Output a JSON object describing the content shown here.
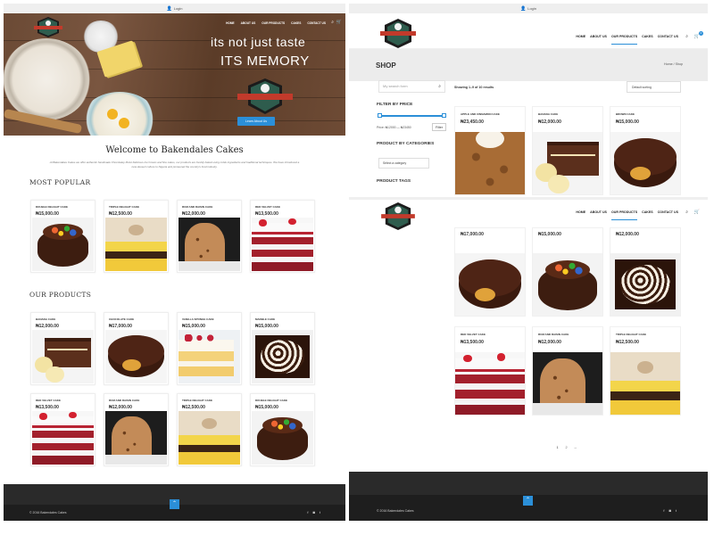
{
  "topbar": {
    "login_label": "Login"
  },
  "nav": {
    "items": [
      "HOME",
      "ABOUT US",
      "OUR PRODUCTS",
      "CAKES",
      "CONTACT US"
    ],
    "active": "OUR PRODUCTS",
    "cart_count": "0"
  },
  "hero": {
    "tagline_1": "its not just taste",
    "tagline_2": "ITS MEMORY",
    "button_label": "Learn About Us"
  },
  "welcome": {
    "title": "Welcome to Bakendales Cakes",
    "text": "At Bakendales Cakes we offer authentic handmade Chocolatey Moist Delicious Ice Cream and fine cakes, our products are freshly baked using noble ingredients and traditional techniques. We have introduced a new dessert culture to Nigeria and pioneered the country's food industry."
  },
  "most_popular": {
    "heading": "MOST POPULAR",
    "products": [
      {
        "name": "DOUBLE DELIGHT CAKE",
        "price": "₦15,000.00",
        "img": "smarties"
      },
      {
        "name": "TRIPLE DELIGHT CAKE",
        "price": "₦12,500.00",
        "img": "triple"
      },
      {
        "name": "RUM AND RAISIN CAKE",
        "price": "₦12,000.00",
        "img": "rum"
      },
      {
        "name": "RED VELVET CAKE",
        "price": "₦13,500.00",
        "img": "velvet"
      }
    ]
  },
  "our_products": {
    "heading": "OUR PRODUCTS",
    "products": [
      {
        "name": "BANANA CAKE",
        "price": "₦12,000.00",
        "img": "banana"
      },
      {
        "name": "CHOCOLATE CAKE",
        "price": "₦17,000.00",
        "img": "chocolate"
      },
      {
        "name": "VANILLA SPONGE CAKE",
        "price": "₦15,000.00",
        "img": "sponge"
      },
      {
        "name": "MARBLE CAKE",
        "price": "₦15,000.00",
        "img": "marble"
      },
      {
        "name": "RED VELVET CAKE",
        "price": "₦13,500.00",
        "img": "velvet"
      },
      {
        "name": "RUM AND RAISIN CAKE",
        "price": "₦12,000.00",
        "img": "rum"
      },
      {
        "name": "TRIPLE DELIGHT CAKE",
        "price": "₦12,500.00",
        "img": "triple"
      },
      {
        "name": "DOUBLE DELIGHT CAKE",
        "price": "₦15,000.00",
        "img": "smarties"
      }
    ]
  },
  "footer": {
    "copyright": "© 2016 Bakendales Cakes",
    "social": [
      "f",
      "◙",
      "t"
    ]
  },
  "shop": {
    "title": "SHOP",
    "breadcrumb": "Home  /  Shop",
    "search_placeholder": "My search form",
    "filter_price_heading": "FILTER BY PRICE",
    "price_range": "Price: ₦12000 — ₦23450",
    "filter_button": "Filter",
    "categories_heading": "PRODUCT BY CATEGORIES",
    "category_select": "Select a category",
    "tags_heading": "PRODUCT TAGS",
    "results_text": "Showing 1–9 of 10 results",
    "sorting": "Default sorting",
    "products_row1": [
      {
        "name": "APPLE AND CINNAMON CAKE",
        "price": "₦23,450.00",
        "img": "apple"
      },
      {
        "name": "BANANA CAKE",
        "price": "₦12,000.00",
        "img": "banana"
      },
      {
        "name": "BROWN CAKE",
        "price": "₦15,000.00",
        "img": "chocolate"
      }
    ],
    "products_row2": [
      {
        "name": "",
        "price": "₦17,000.00",
        "img": "chocolate"
      },
      {
        "name": "",
        "price": "₦15,000.00",
        "img": "smarties"
      },
      {
        "name": "",
        "price": "₦12,000.00",
        "img": "marble"
      }
    ],
    "products_row3": [
      {
        "name": "RED VELVET CAKE",
        "price": "₦13,500.00",
        "img": "velvet"
      },
      {
        "name": "RUM AND RAISIN CAKE",
        "price": "₦12,000.00",
        "img": "rum"
      },
      {
        "name": "TRIPLE DELIGHT CAKE",
        "price": "₦12,500.00",
        "img": "triple"
      }
    ],
    "pagination": [
      "1",
      "2",
      "→"
    ]
  },
  "icons": {
    "login": "user-icon",
    "search": "search-icon",
    "cart": "cart-icon",
    "scroll_top": "chevron-up-icon"
  },
  "colors": {
    "accent": "#2b8fd8",
    "footer": "#1e1e1e",
    "banner": "#ececec"
  }
}
